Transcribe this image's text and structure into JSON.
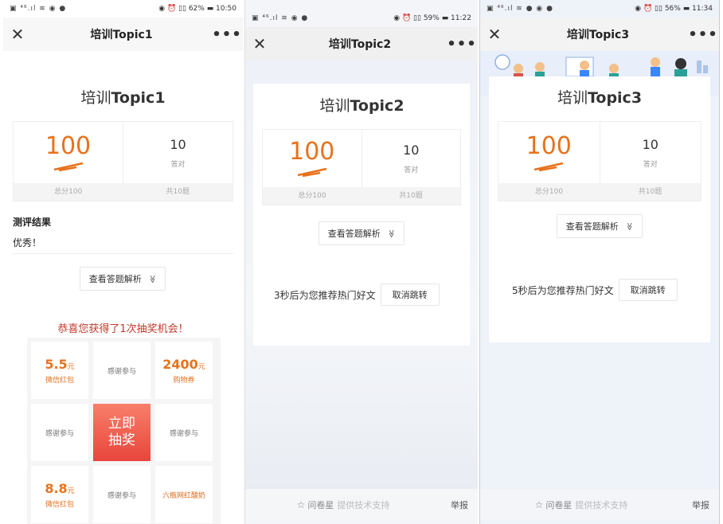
{
  "phones": [
    {
      "status_left": "▣ ⁴⁶.ıl ≋ ◉ ●",
      "status_right": "◉ ⏰ ▯▯ 62% ▬ 10:50",
      "nav_title": "培训Topic1",
      "card_title_prefix": "培训",
      "card_title_bold": "Topic1",
      "score": "100",
      "correct": "10",
      "correct_label": "答对",
      "total_score": "总分100",
      "total_questions": "共10题",
      "result_heading": "测评结果",
      "result_text": "优秀！",
      "analysis_button": "查看答题解析",
      "lottery_title": "恭喜您获得了1次抽奖机会！",
      "prizes": [
        {
          "amount": "5.5",
          "unit": "元",
          "name": "微信红包"
        },
        {
          "thanks": "感谢参与"
        },
        {
          "amount": "2400",
          "unit": "元",
          "name": "购物券"
        },
        {
          "thanks": "感谢参与"
        },
        {
          "draw": "立即抽奖"
        },
        {
          "thanks": "感谢参与"
        },
        {
          "amount": "8.8",
          "unit": "元",
          "name": "微信红包"
        },
        {
          "thanks": "感谢参与"
        },
        {
          "text": "六瓶网红酸奶"
        }
      ]
    },
    {
      "status_left": "▣ ⁴⁶.ıl ≋ ◉ ●",
      "status_right": "◉ ⏰ ▯▯ 59% ▬ 11:22",
      "nav_title": "培训Topic2",
      "card_title_prefix": "培训",
      "card_title_bold": "Topic2",
      "score": "100",
      "correct": "10",
      "correct_label": "答对",
      "total_score": "总分100",
      "total_questions": "共10题",
      "analysis_button": "查看答题解析",
      "redirect_text": "3秒后为您推荐热门好文",
      "cancel_button": "取消跳转",
      "footer_brand": "问卷星",
      "footer_support": "提供技术支持",
      "footer_report": "举报"
    },
    {
      "status_left": "▣ ⁴⁶.ıl ≋ ● ◉ ●",
      "status_right": "◉ ⏰ ▯▯ 56% ▬ 11:34",
      "nav_title": "培训Topic3",
      "card_title_prefix": "培训",
      "card_title_bold": "Topic3",
      "score": "100",
      "correct": "10",
      "correct_label": "答对",
      "total_score": "总分100",
      "total_questions": "共10题",
      "analysis_button": "查看答题解析",
      "redirect_text": "5秒后为您推荐热门好文",
      "cancel_button": "取消跳转",
      "footer_brand": "问卷星",
      "footer_support": "提供技术支持",
      "footer_report": "举报"
    }
  ],
  "icons": {
    "close": "✕",
    "more": "•••",
    "chevron": "≫",
    "star": "☆"
  },
  "colors": {
    "score_orange": "#e8721c",
    "lottery_red": "#c0392b",
    "draw_gradient_top": "#f87f6a",
    "draw_gradient_bottom": "#e8453c"
  }
}
